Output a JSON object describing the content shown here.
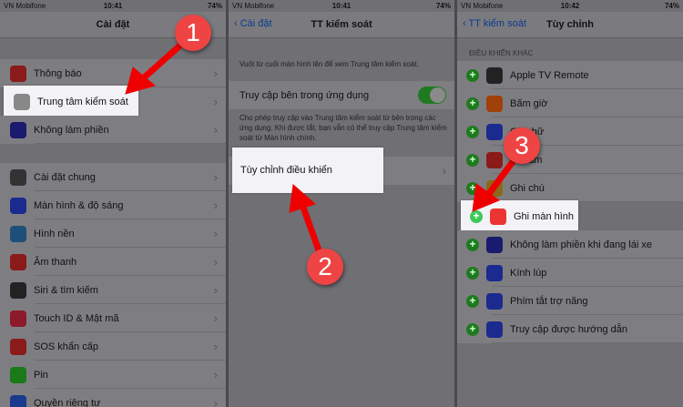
{
  "status_bar": {
    "carrier": "VN Mobifone",
    "battery": "74%",
    "times": [
      "10:41",
      "10:41",
      "10:42"
    ]
  },
  "panel1": {
    "title": "Cài đặt",
    "group1": [
      "Thông báo",
      "Trung tâm kiểm soát",
      "Không làm phiền"
    ],
    "group2": [
      "Cài đặt chung",
      "Màn hình & độ sáng",
      "Hình nền",
      "Âm thanh",
      "Siri & tìm kiếm",
      "Touch ID & Mật mã",
      "SOS khẩn cấp",
      "Pin",
      "Quyền riêng tư"
    ]
  },
  "panel2": {
    "back": "Cài đặt",
    "title": "TT kiểm soát",
    "hint": "Vuốt từ cuối màn hình lên để xem Trung tâm kiểm soát.",
    "toggle_label": "Truy cập bên trong ứng dụng",
    "toggle_on": true,
    "footnote": "Cho phép truy cập vào Trung tâm kiểm soát từ bên trong các ứng dụng. Khi được tắt, bạn vẫn có thể truy cập Trung tâm kiểm soát từ Màn hình chính.",
    "customize": "Tùy chỉnh điều khiển"
  },
  "panel3": {
    "back": "TT kiểm soát",
    "title": "Tùy chỉnh",
    "section": "ĐIỀU KHIỂN KHÁC",
    "items": [
      "Apple TV Remote",
      "Bấm giờ",
      "Cỡ chữ",
      "Ghi âm",
      "Ghi chú",
      "Ghi màn hình",
      "Không làm phiền khi đang lái xe",
      "Kính lúp",
      "Phím tắt trợ năng",
      "Truy cập được hướng dẫn"
    ]
  },
  "steps": [
    "1",
    "2",
    "3"
  ],
  "colors": {
    "arrow": "#ee0000",
    "badge": "#ef4444",
    "toggle": "#1f7a1f"
  }
}
